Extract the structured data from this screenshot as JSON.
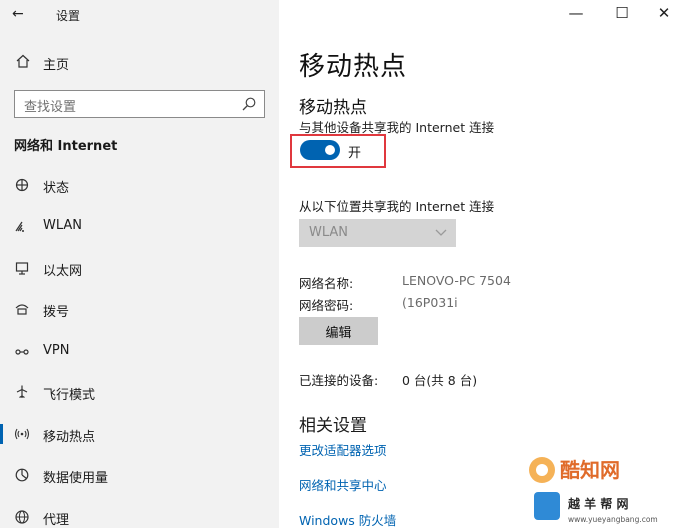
{
  "app": {
    "title": "设置"
  },
  "sidebar": {
    "home": "主页",
    "search_placeholder": "查找设置",
    "section": "网络和 Internet",
    "items": [
      {
        "label": "状态",
        "icon": "status-icon"
      },
      {
        "label": "WLAN",
        "icon": "wifi-icon"
      },
      {
        "label": "以太网",
        "icon": "ethernet-icon"
      },
      {
        "label": "拨号",
        "icon": "dialup-icon"
      },
      {
        "label": "VPN",
        "icon": "vpn-icon"
      },
      {
        "label": "飞行模式",
        "icon": "airplane-icon"
      },
      {
        "label": "移动热点",
        "icon": "hotspot-icon",
        "active": true
      },
      {
        "label": "数据使用量",
        "icon": "data-usage-icon"
      },
      {
        "label": "代理",
        "icon": "globe-icon"
      }
    ]
  },
  "window_controls": {
    "minimize": "—",
    "maximize": "☐",
    "close": "✕"
  },
  "main": {
    "title": "移动热点",
    "hotspot": {
      "heading": "移动热点",
      "description": "与其他设备共享我的 Internet 连接",
      "toggle_state": "开",
      "toggle_on": true
    },
    "share_from": {
      "label": "从以下位置共享我的 Internet 连接",
      "selected": "WLAN"
    },
    "network_name_label": "网络名称:",
    "network_name_value": "LENOVO-PC 7504",
    "network_password_label": "网络密码:",
    "network_password_value": "(16P031i",
    "edit_button": "编辑",
    "connected_label": "已连接的设备:",
    "connected_value": "0 台(共 8 台)",
    "related_heading": "相关设置",
    "links": [
      "更改适配器选项",
      "网络和共享中心",
      "Windows 防火墙"
    ]
  },
  "watermark": {
    "text": "酷知网",
    "subtext": "www.yueyangbang.com"
  },
  "colors": {
    "accent": "#0063b1",
    "highlight_box": "#e0383e",
    "sidebar_bg": "#f2f2f2"
  }
}
